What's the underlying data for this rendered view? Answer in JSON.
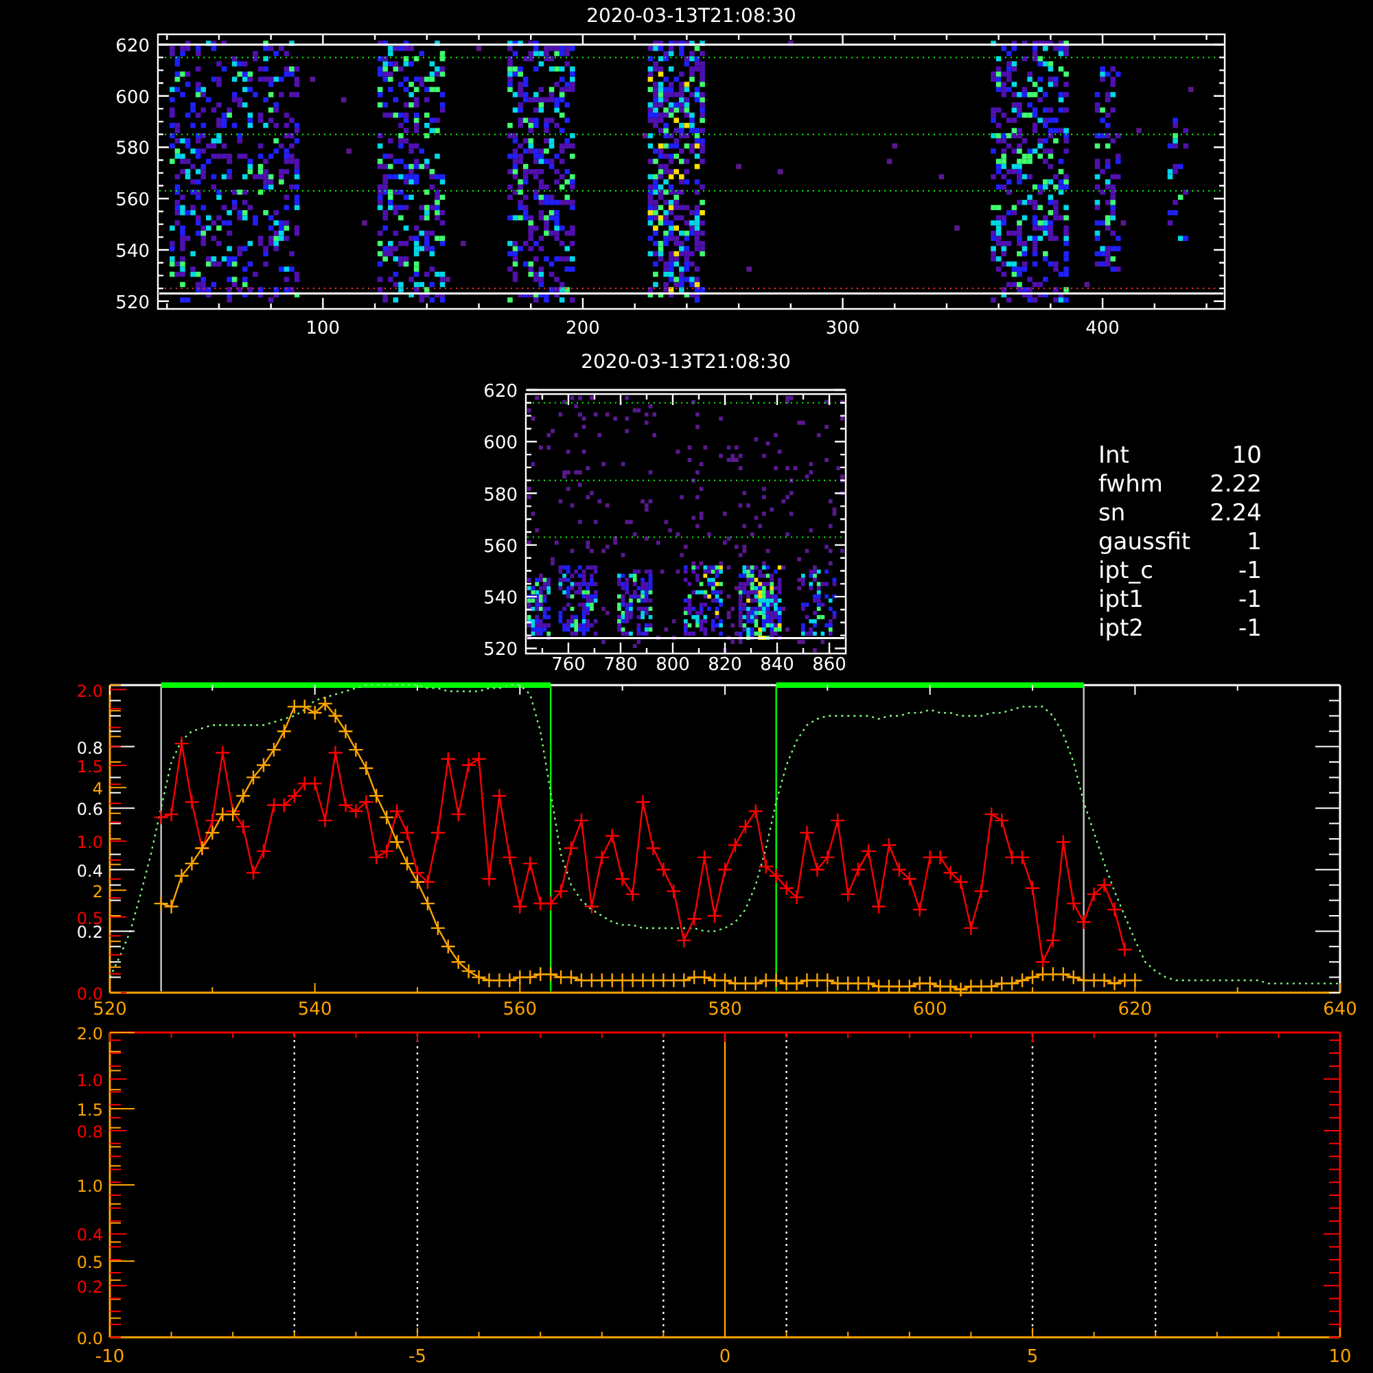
{
  "detector_panel": {
    "title": "2020-03-13T21:08:30",
    "xticks": [
      "100",
      "200",
      "300",
      "400"
    ],
    "yticks": [
      "620",
      "600",
      "580",
      "560",
      "540",
      "520"
    ]
  },
  "zoom_panel": {
    "title": "2020-03-13T21:08:30",
    "xticks": [
      "760",
      "780",
      "800",
      "820",
      "840",
      "860"
    ],
    "yticks": [
      "620",
      "600",
      "580",
      "560",
      "540",
      "520"
    ]
  },
  "fit_parameters": [
    {
      "label": "Int",
      "value": "10"
    },
    {
      "label": "fwhm",
      "value": "2.22"
    },
    {
      "label": "sn",
      "value": "2.24"
    },
    {
      "label": "gaussfit",
      "value": "1"
    },
    {
      "label": "ipt_c",
      "value": "-1"
    },
    {
      "label": "ipt1",
      "value": "-1"
    },
    {
      "label": "ipt2",
      "value": "-1"
    }
  ],
  "spectrum_plot": {
    "chart_data": {
      "type": "line",
      "xlim": [
        520,
        640
      ],
      "ylim": [
        0,
        1
      ],
      "xticks": [
        520,
        540,
        560,
        580,
        600,
        620,
        640
      ],
      "yticks": [
        0.8,
        0.6,
        0.4,
        0.2
      ],
      "x": [
        520,
        521,
        522,
        523,
        524,
        525,
        526,
        527,
        528,
        529,
        530,
        531,
        532,
        533,
        534,
        535,
        536,
        537,
        538,
        539,
        540,
        541,
        542,
        543,
        544,
        545,
        546,
        547,
        548,
        549,
        550,
        551,
        552,
        553,
        554,
        555,
        556,
        557,
        558,
        559,
        560,
        561,
        562,
        563,
        564,
        565,
        566,
        567,
        568,
        569,
        570,
        571,
        572,
        573,
        574,
        575,
        576,
        577,
        578,
        579,
        580,
        581,
        582,
        583,
        584,
        585,
        586,
        587,
        588,
        589,
        590,
        591,
        592,
        593,
        594,
        595,
        596,
        597,
        598,
        599,
        600,
        601,
        602,
        603,
        604,
        605,
        606,
        607,
        608,
        609,
        610,
        611,
        612,
        613,
        614,
        615,
        616,
        617,
        618,
        619,
        620,
        621,
        622,
        623,
        624,
        625,
        626,
        627,
        628,
        629,
        630,
        631,
        632,
        633,
        634,
        635,
        636,
        637,
        638,
        639,
        640
      ],
      "series": [
        {
          "color": "#00ff00",
          "line_style": "solid",
          "values": [
            null,
            null,
            null,
            null,
            null,
            1,
            1,
            1,
            1,
            1,
            1,
            1,
            1,
            1,
            1,
            1,
            1,
            1,
            1,
            1,
            1,
            1,
            1,
            1,
            1,
            1,
            1,
            1,
            1,
            1,
            1,
            1,
            1,
            1,
            1,
            1,
            1,
            1,
            1,
            1,
            1,
            1,
            1,
            1,
            null,
            null,
            null,
            null,
            null,
            null,
            null,
            null,
            null,
            null,
            null,
            null,
            null,
            null,
            null,
            null,
            null,
            null,
            null,
            null,
            null,
            1,
            1,
            1,
            1,
            1,
            1,
            1,
            1,
            1,
            1,
            1,
            1,
            1,
            1,
            1,
            1,
            1,
            1,
            1,
            1,
            1,
            1,
            1,
            1,
            1,
            1,
            1,
            1,
            1,
            1,
            1,
            null,
            null,
            null,
            null,
            null,
            null,
            null,
            null,
            null,
            null,
            null,
            null,
            null,
            null,
            null,
            null,
            null,
            null,
            null,
            null,
            null,
            null,
            null,
            null,
            null
          ]
        },
        {
          "color": "#80ff80",
          "line_style": "dotted",
          "values": [
            0.05,
            0.12,
            0.2,
            0.32,
            0.45,
            0.6,
            0.75,
            0.82,
            0.85,
            0.86,
            0.87,
            0.87,
            0.87,
            0.87,
            0.87,
            0.87,
            0.88,
            0.89,
            0.9,
            0.92,
            0.95,
            0.96,
            0.97,
            0.98,
            0.99,
            1.0,
            1.0,
            1.0,
            1.0,
            1.0,
            1.0,
            0.99,
            0.99,
            0.98,
            0.98,
            0.98,
            0.98,
            0.99,
            0.99,
            1.0,
            1.0,
            0.97,
            0.85,
            0.65,
            0.45,
            0.35,
            0.3,
            0.27,
            0.25,
            0.23,
            0.22,
            0.22,
            0.21,
            0.21,
            0.21,
            0.21,
            0.21,
            0.21,
            0.2,
            0.2,
            0.21,
            0.23,
            0.27,
            0.35,
            0.47,
            0.62,
            0.74,
            0.82,
            0.87,
            0.89,
            0.9,
            0.9,
            0.9,
            0.9,
            0.9,
            0.89,
            0.9,
            0.9,
            0.91,
            0.91,
            0.92,
            0.91,
            0.91,
            0.9,
            0.9,
            0.9,
            0.91,
            0.91,
            0.92,
            0.93,
            0.93,
            0.93,
            0.9,
            0.84,
            0.75,
            0.62,
            0.52,
            0.42,
            0.33,
            0.25,
            0.17,
            0.1,
            0.07,
            0.05,
            0.04,
            0.04,
            0.04,
            0.04,
            0.04,
            0.04,
            0.04,
            0.04,
            0.04,
            0.03,
            0.03,
            0.03,
            0.03,
            0.03,
            0.03,
            0.03,
            0.03
          ]
        },
        {
          "color": "#ff0000",
          "marker": "+",
          "values": [
            null,
            null,
            null,
            null,
            null,
            0.57,
            0.58,
            0.81,
            0.62,
            0.47,
            0.56,
            0.78,
            0.59,
            0.54,
            0.39,
            0.46,
            0.61,
            0.61,
            0.64,
            0.68,
            0.68,
            0.56,
            0.78,
            0.61,
            0.59,
            0.62,
            0.44,
            0.46,
            0.59,
            0.52,
            0.39,
            0.36,
            0.52,
            0.76,
            0.58,
            0.74,
            0.76,
            0.37,
            0.64,
            0.44,
            0.28,
            0.42,
            0.29,
            0.29,
            0.33,
            0.47,
            0.56,
            0.28,
            0.44,
            0.51,
            0.37,
            0.32,
            0.62,
            0.47,
            0.4,
            0.33,
            0.17,
            0.24,
            0.44,
            0.25,
            0.4,
            0.48,
            0.54,
            0.59,
            0.41,
            0.38,
            0.34,
            0.31,
            0.52,
            0.4,
            0.44,
            0.56,
            0.32,
            0.4,
            0.46,
            0.28,
            0.48,
            0.4,
            0.37,
            0.27,
            0.44,
            0.44,
            0.39,
            0.36,
            0.21,
            0.33,
            0.58,
            0.56,
            0.44,
            0.44,
            0.34,
            0.1,
            0.17,
            0.49,
            0.29,
            0.23,
            0.32,
            0.35,
            0.27,
            0.14,
            null,
            null,
            null,
            null,
            null,
            null,
            null,
            null,
            null,
            null,
            null,
            null,
            null,
            null,
            null,
            null,
            null,
            null,
            null,
            null,
            null
          ]
        },
        {
          "color": "#ffa500",
          "marker": "+",
          "values": [
            null,
            null,
            null,
            null,
            null,
            0.29,
            0.28,
            0.38,
            0.42,
            0.47,
            0.52,
            0.58,
            0.58,
            0.64,
            0.7,
            0.74,
            0.79,
            0.85,
            0.93,
            0.93,
            0.91,
            0.94,
            0.9,
            0.85,
            0.79,
            0.73,
            0.64,
            0.57,
            0.49,
            0.42,
            0.36,
            0.29,
            0.21,
            0.15,
            0.1,
            0.07,
            0.05,
            0.04,
            0.04,
            0.04,
            0.05,
            0.05,
            0.06,
            0.06,
            0.05,
            0.05,
            0.04,
            0.04,
            0.04,
            0.04,
            0.04,
            0.04,
            0.04,
            0.04,
            0.04,
            0.04,
            0.04,
            0.05,
            0.05,
            0.04,
            0.04,
            0.03,
            0.03,
            0.03,
            0.04,
            0.04,
            0.03,
            0.03,
            0.04,
            0.04,
            0.04,
            0.03,
            0.03,
            0.03,
            0.03,
            0.02,
            0.02,
            0.02,
            0.02,
            0.03,
            0.03,
            0.02,
            0.02,
            0.01,
            0.02,
            0.02,
            0.02,
            0.03,
            0.03,
            0.04,
            0.05,
            0.06,
            0.06,
            0.06,
            0.05,
            0.04,
            0.04,
            0.04,
            0.03,
            0.04,
            0.04,
            null,
            null,
            null,
            null,
            null,
            null,
            null,
            null,
            null,
            null,
            null,
            null,
            null,
            null,
            null,
            null,
            null,
            null,
            null,
            null
          ]
        }
      ],
      "ref_lines": [
        {
          "axis": "x",
          "value": 525,
          "color": "#c8c8c8",
          "line_style": "solid"
        },
        {
          "axis": "x",
          "value": 563,
          "color": "#00ff00",
          "line_style": "solid"
        },
        {
          "axis": "x",
          "value": 585,
          "color": "#00ff00",
          "line_style": "solid"
        },
        {
          "axis": "x",
          "value": 615,
          "color": "#c8c8c8",
          "line_style": "solid"
        }
      ]
    },
    "secondary_axes": [
      {
        "color": "#ff0000",
        "labels": [
          "2.0",
          "1.5",
          "1.0",
          "0.5",
          "0.0"
        ]
      },
      {
        "color": "#ffa500",
        "labels": [
          "4",
          "2"
        ]
      }
    ]
  },
  "offset_plot": {
    "chart_data": {
      "type": "line",
      "xlim": [
        -10,
        10
      ],
      "ylim": [
        0,
        2
      ],
      "xticks": [
        {
          "value": -10,
          "label": "-10"
        },
        {
          "value": -5,
          "label": "-5"
        },
        0,
        5,
        10
      ],
      "yticks": [
        {
          "value": 2,
          "label": "2.0"
        },
        {
          "value": 1.5,
          "label": "1.5"
        },
        {
          "value": 1,
          "label": "1.0"
        },
        {
          "value": 0.5,
          "label": "0.5"
        },
        {
          "value": 0,
          "label": "0.0"
        }
      ],
      "ref_lines": [
        {
          "axis": "x",
          "value": -7,
          "color": "#ffffff",
          "line_style": "dotted"
        },
        {
          "axis": "x",
          "value": -5,
          "color": "#ffffff",
          "line_style": "dotted"
        },
        {
          "axis": "x",
          "value": -1,
          "color": "#ffffff",
          "line_style": "dotted"
        },
        {
          "axis": "x",
          "value": 0,
          "color": "#ffa500",
          "line_style": "solid"
        },
        {
          "axis": "x",
          "value": 1,
          "color": "#ffffff",
          "line_style": "dotted"
        },
        {
          "axis": "x",
          "value": 5,
          "color": "#ffffff",
          "line_style": "dotted"
        },
        {
          "axis": "x",
          "value": 7,
          "color": "#ffffff",
          "line_style": "dotted"
        }
      ]
    },
    "secondary_axes": [
      {
        "color": "#ff0000",
        "labels": [
          "1.0",
          "0.8",
          "0.4",
          "0.2"
        ]
      }
    ]
  }
}
